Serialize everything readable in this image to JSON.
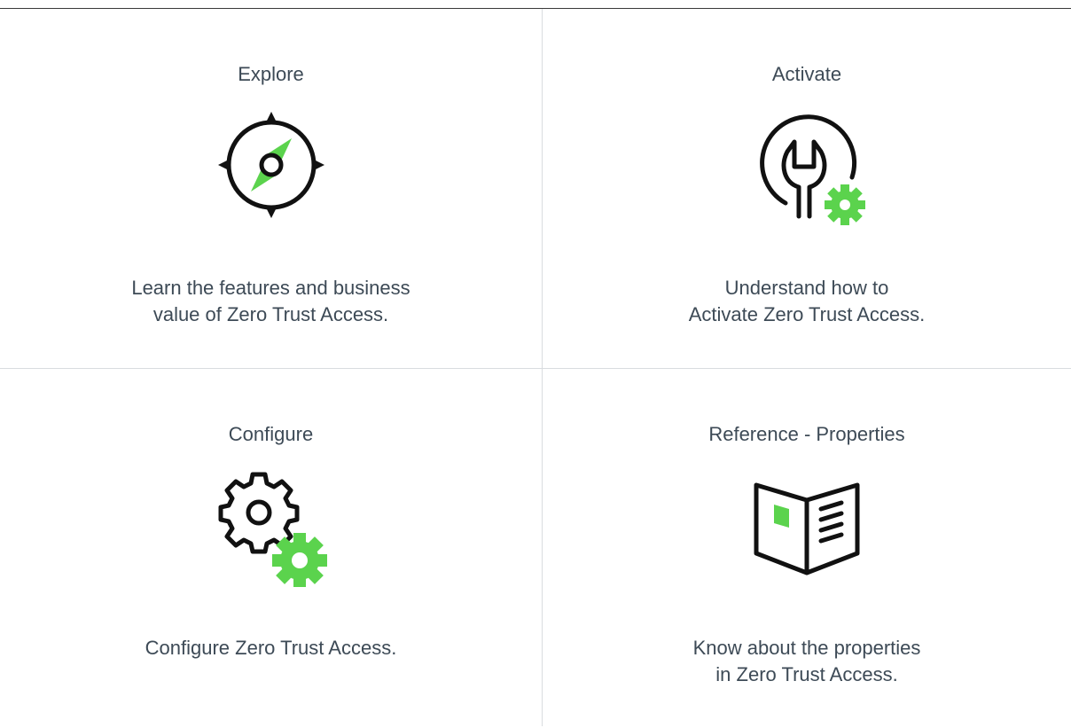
{
  "cards": [
    {
      "title": "Explore",
      "icon": "compass-icon",
      "description_lines": [
        "Learn the features and business",
        "value of Zero Trust Access."
      ]
    },
    {
      "title": "Activate",
      "icon": "wrench-gear-icon",
      "description_lines": [
        "Understand how to",
        "Activate Zero Trust Access."
      ]
    },
    {
      "title": "Configure",
      "icon": "gears-icon",
      "description_lines": [
        "Configure Zero Trust Access."
      ]
    },
    {
      "title": "Reference - Properties",
      "icon": "open-book-icon",
      "description_lines": [
        "Know about the properties",
        "in Zero Trust Access."
      ]
    }
  ],
  "colors": {
    "text": "#3d4a56",
    "accent_green": "#5bd34d",
    "icon_stroke": "#111111",
    "divider": "#d9dcdf"
  }
}
